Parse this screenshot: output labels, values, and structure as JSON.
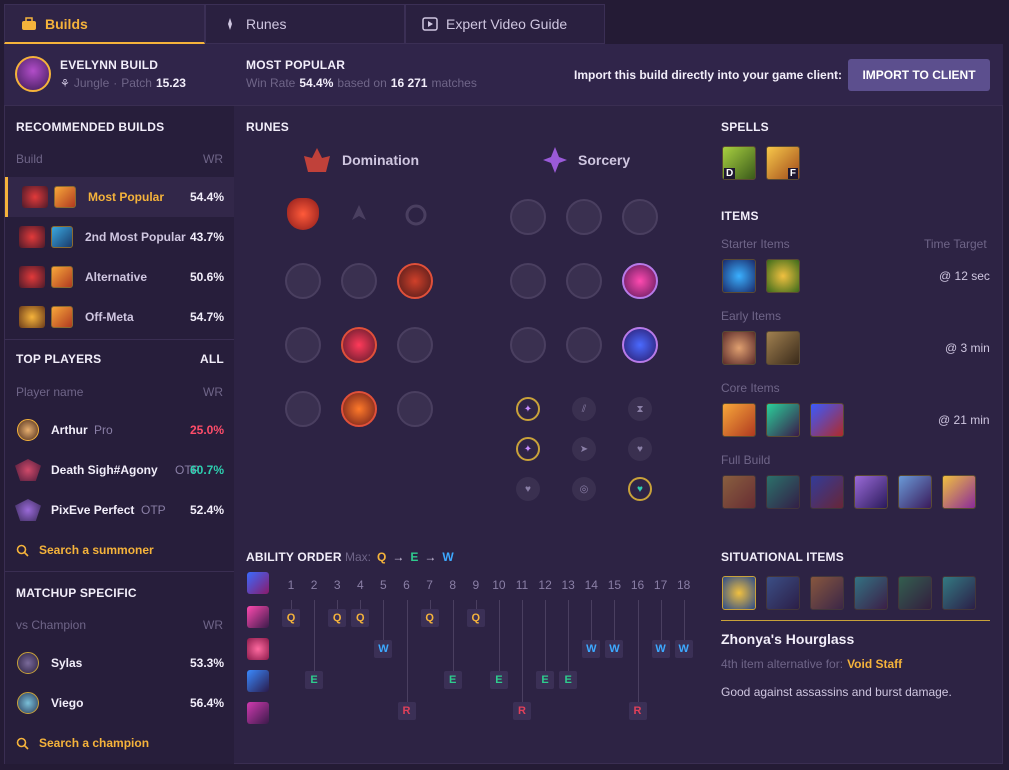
{
  "tabs": [
    {
      "label": "Builds"
    },
    {
      "label": "Runes"
    },
    {
      "label": "Expert Video Guide"
    }
  ],
  "champion": {
    "name": "EVELYNN BUILD",
    "role": "Jungle",
    "patch_label": "Patch",
    "patch": "15.23"
  },
  "popular": {
    "title": "MOST POPULAR",
    "wr_label": "Win Rate",
    "wr": "54.4%",
    "based_on": "based on",
    "matches": "16 271",
    "matches_label": "matches"
  },
  "import": {
    "text": "Import this build directly into your game client:",
    "button": "IMPORT TO CLIENT"
  },
  "recommended": {
    "title": "RECOMMENDED BUILDS",
    "col_build": "Build",
    "col_wr": "WR",
    "rows": [
      {
        "name": "Most Popular",
        "wr": "54.4%"
      },
      {
        "name": "2nd Most Popular",
        "wr": "43.7%"
      },
      {
        "name": "Alternative",
        "wr": "50.6%"
      },
      {
        "name": "Off-Meta",
        "wr": "54.7%"
      }
    ]
  },
  "top_players": {
    "title": "TOP PLAYERS",
    "all": "ALL",
    "col_name": "Player name",
    "col_wr": "WR",
    "rows": [
      {
        "name": "Arthur",
        "tag": "Pro",
        "wr": "25.0%",
        "wr_color": "#ff4d6a"
      },
      {
        "name": "Death Sigh#Agony",
        "tag": "OTP",
        "wr": "60.7%",
        "wr_color": "#2ed0b0"
      },
      {
        "name": "PixEve Perfect",
        "tag": "OTP",
        "wr": "52.4%",
        "wr_color": "#f2eefa"
      }
    ],
    "search": "Search a summoner"
  },
  "matchup": {
    "title": "MATCHUP SPECIFIC",
    "col_name": "vs Champion",
    "col_wr": "WR",
    "rows": [
      {
        "name": "Sylas",
        "wr": "53.3%"
      },
      {
        "name": "Viego",
        "wr": "56.4%"
      }
    ],
    "search": "Search a champion"
  },
  "runes": {
    "title": "RUNES",
    "primary": "Domination",
    "secondary": "Sorcery"
  },
  "spells": {
    "title": "SPELLS",
    "keys": [
      "D",
      "F"
    ]
  },
  "items": {
    "title": "ITEMS",
    "starter": "Starter Items",
    "time_target": "Time Target",
    "starter_time": "@ 12 sec",
    "early": "Early Items",
    "early_time": "@ 3 min",
    "core": "Core Items",
    "core_time": "@ 21 min",
    "full": "Full Build"
  },
  "ability": {
    "title": "ABILITY ORDER",
    "max_label": "Max:",
    "max": [
      "Q",
      "E",
      "W"
    ],
    "levels": [
      "1",
      "2",
      "3",
      "4",
      "5",
      "6",
      "7",
      "8",
      "9",
      "10",
      "11",
      "12",
      "13",
      "14",
      "15",
      "16",
      "17",
      "18"
    ],
    "order": [
      "Q",
      "E",
      "Q",
      "Q",
      "W",
      "R",
      "Q",
      "E",
      "Q",
      "E",
      "R",
      "E",
      "E",
      "W",
      "W",
      "R",
      "W",
      "W"
    ]
  },
  "situational": {
    "title": "SITUATIONAL ITEMS",
    "item": "Zhonya's Hourglass",
    "alt_prefix": "4th item alternative for:",
    "alt_item": "Void Staff",
    "desc": "Good against assassins and burst damage."
  }
}
